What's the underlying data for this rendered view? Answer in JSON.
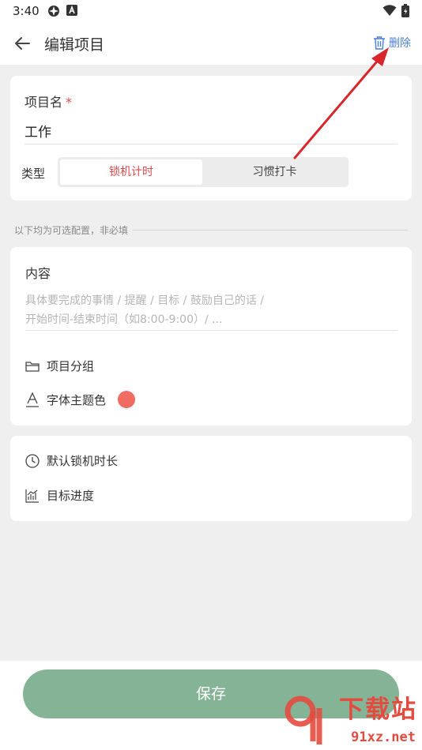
{
  "status_bar": {
    "time": "3:40"
  },
  "app_bar": {
    "title": "编辑项目",
    "delete_label": "删除"
  },
  "card_basic": {
    "name_label": "项目名",
    "required_mark": "*",
    "name_value": "工作",
    "type_label": "类型",
    "type_options": [
      "锁机计时",
      "习惯打卡"
    ],
    "type_selected": "锁机计时"
  },
  "optional_hint": "以下均为可选配置，非必填",
  "card_content": {
    "content_label": "内容",
    "content_placeholder_line1": "具体要完成的事情 /  提醒 / 目标 / 鼓励自己的话 /",
    "content_placeholder_line2": "开始时间-结束时间（如8:00-9:00）/ ...",
    "group_label": "项目分组",
    "font_color_label": "字体主题色",
    "font_color": "#f06b62"
  },
  "card_settings": {
    "lock_duration_label": "默认锁机时长",
    "goal_progress_label": "目标进度"
  },
  "save_label": "保存",
  "watermark": {
    "text": "下载站",
    "url": "91xz.net"
  },
  "colors": {
    "accent_red": "#d84a4a",
    "link_blue": "#4a7fd8",
    "save_green": "#84b495",
    "annotation_arrow": "#d9262b"
  },
  "icons": [
    "back-arrow-icon",
    "trash-icon",
    "folder-icon",
    "font-a-icon",
    "clock-icon",
    "chart-icon"
  ]
}
